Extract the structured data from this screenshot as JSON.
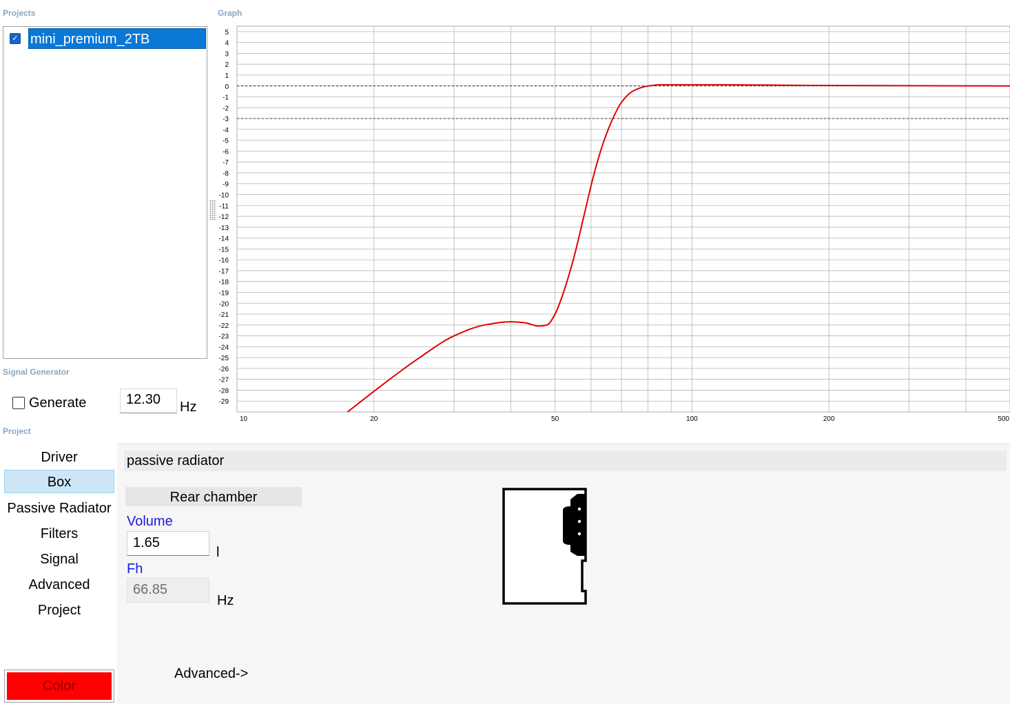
{
  "labels": {
    "projects": "Projects",
    "graph": "Graph",
    "signal_generator": "Signal Generator",
    "project": "Project"
  },
  "projects": {
    "items": [
      {
        "name": "mini_premium_2TB",
        "checked": true,
        "selected": true
      }
    ]
  },
  "signal_generator": {
    "generate_label": "Generate",
    "generate_checked": false,
    "frequency": "12.30",
    "unit": "Hz"
  },
  "nav": {
    "items": [
      "Driver",
      "Box",
      "Passive Radiator",
      "Filters",
      "Signal",
      "Advanced",
      "Project"
    ],
    "selected": "Box"
  },
  "color_button": {
    "label": "Color",
    "color": "#ff0000"
  },
  "content": {
    "header": "passive radiator",
    "rear_chamber": "Rear chamber",
    "volume_label": "Volume",
    "volume_value": "1.65",
    "volume_unit": "l",
    "fh_label": "Fh",
    "fh_value": "66.85",
    "fh_unit": "Hz",
    "advanced_link": "Advanced->"
  },
  "chart_data": {
    "type": "line",
    "x_scale": "log",
    "xlim": [
      10,
      500
    ],
    "ylim": [
      -30,
      5
    ],
    "x_ticks": [
      10,
      20,
      50,
      100,
      200,
      500
    ],
    "y_ticks": [
      5,
      4,
      3,
      2,
      1,
      0,
      -1,
      -2,
      -3,
      -4,
      -5,
      -6,
      -7,
      -8,
      -9,
      -10,
      -11,
      -12,
      -13,
      -14,
      -15,
      -16,
      -17,
      -18,
      -19,
      -20,
      -21,
      -22,
      -23,
      -24,
      -25,
      -26,
      -27,
      -28,
      -29
    ],
    "reference_lines": [
      0,
      -3
    ],
    "grid": true,
    "series": [
      {
        "color": "#e00000",
        "points": [
          [
            17.5,
            -30
          ],
          [
            20,
            -28.1
          ],
          [
            25,
            -25.1
          ],
          [
            30,
            -23
          ],
          [
            35,
            -22
          ],
          [
            40,
            -21.7
          ],
          [
            43,
            -21.8
          ],
          [
            46,
            -22.1
          ],
          [
            48,
            -22
          ],
          [
            50,
            -21
          ],
          [
            52,
            -19.2
          ],
          [
            55,
            -15.8
          ],
          [
            58,
            -11.8
          ],
          [
            61,
            -8
          ],
          [
            64,
            -5.1
          ],
          [
            67,
            -3
          ],
          [
            70,
            -1.5
          ],
          [
            74,
            -0.5
          ],
          [
            79,
            -0.05
          ],
          [
            85,
            0.1
          ],
          [
            95,
            0.1
          ],
          [
            120,
            0.1
          ],
          [
            180,
            0.05
          ],
          [
            500,
            0
          ]
        ]
      }
    ]
  }
}
